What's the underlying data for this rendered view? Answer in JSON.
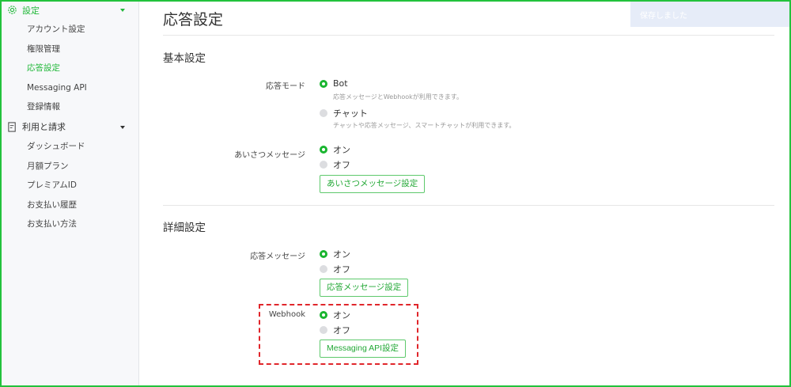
{
  "sidebar": {
    "groups": [
      {
        "label": "設定",
        "icon": "gear-icon",
        "items": [
          "アカウント設定",
          "権限管理",
          "応答設定",
          "Messaging API",
          "登録情報"
        ]
      },
      {
        "label": "利用と請求",
        "icon": "invoice-icon",
        "items": [
          "ダッシュボード",
          "月額プラン",
          "プレミアムID",
          "お支払い履歴",
          "お支払い方法"
        ]
      }
    ]
  },
  "toast": "保存しました",
  "page": {
    "title": "応答設定",
    "basic": {
      "title": "基本設定",
      "mode": {
        "label": "応答モード",
        "bot": "Bot",
        "bot_desc": "応答メッセージとWebhookが利用できます。",
        "chat": "チャット",
        "chat_desc": "チャットや応答メッセージ、スマートチャットが利用できます。"
      },
      "greeting": {
        "label": "あいさつメッセージ",
        "on": "オン",
        "off": "オフ",
        "button": "あいさつメッセージ設定"
      }
    },
    "detail": {
      "title": "詳細設定",
      "reply": {
        "label": "応答メッセージ",
        "on": "オン",
        "off": "オフ",
        "button": "応答メッセージ設定"
      },
      "webhook": {
        "label": "Webhook",
        "on": "オン",
        "off": "オフ",
        "button": "Messaging API設定"
      }
    }
  },
  "colors": {
    "accent": "#22b83a",
    "highlight": "#e0262b"
  }
}
